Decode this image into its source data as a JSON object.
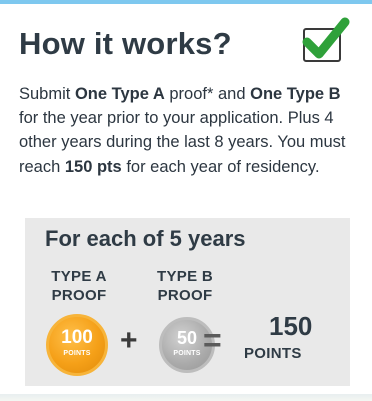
{
  "card": {
    "heading": "How it works?",
    "check_icon": "checked-box-icon",
    "description": {
      "p1": "Submit ",
      "b1": "One Type A",
      "p2": " proof* and ",
      "b2": "One Type B",
      "p3": " for the year prior to your application. Plus 4 other years during the last 8 years. You must reach ",
      "b3": "150 pts",
      "p4": " for each year of residency."
    }
  },
  "points_panel": {
    "title": "For each of 5 years",
    "type_a": {
      "line1": "TYPE A",
      "line2": "PROOF"
    },
    "type_b": {
      "line1": "TYPE B",
      "line2": "PROOF"
    },
    "badge_a": {
      "value": "100",
      "unit": "POINTS"
    },
    "badge_b": {
      "value": "50",
      "unit": "POINTS"
    },
    "plus_sign": "+",
    "equals_sign": "=",
    "total": {
      "value": "150",
      "unit": "POINTS"
    }
  },
  "colors": {
    "accent_strip": "#7ec8ef",
    "check_green": "#2fa13a",
    "badge_a": "#f5a018",
    "badge_b": "#aaaaaa",
    "panel_bg": "#e9e9e9"
  }
}
